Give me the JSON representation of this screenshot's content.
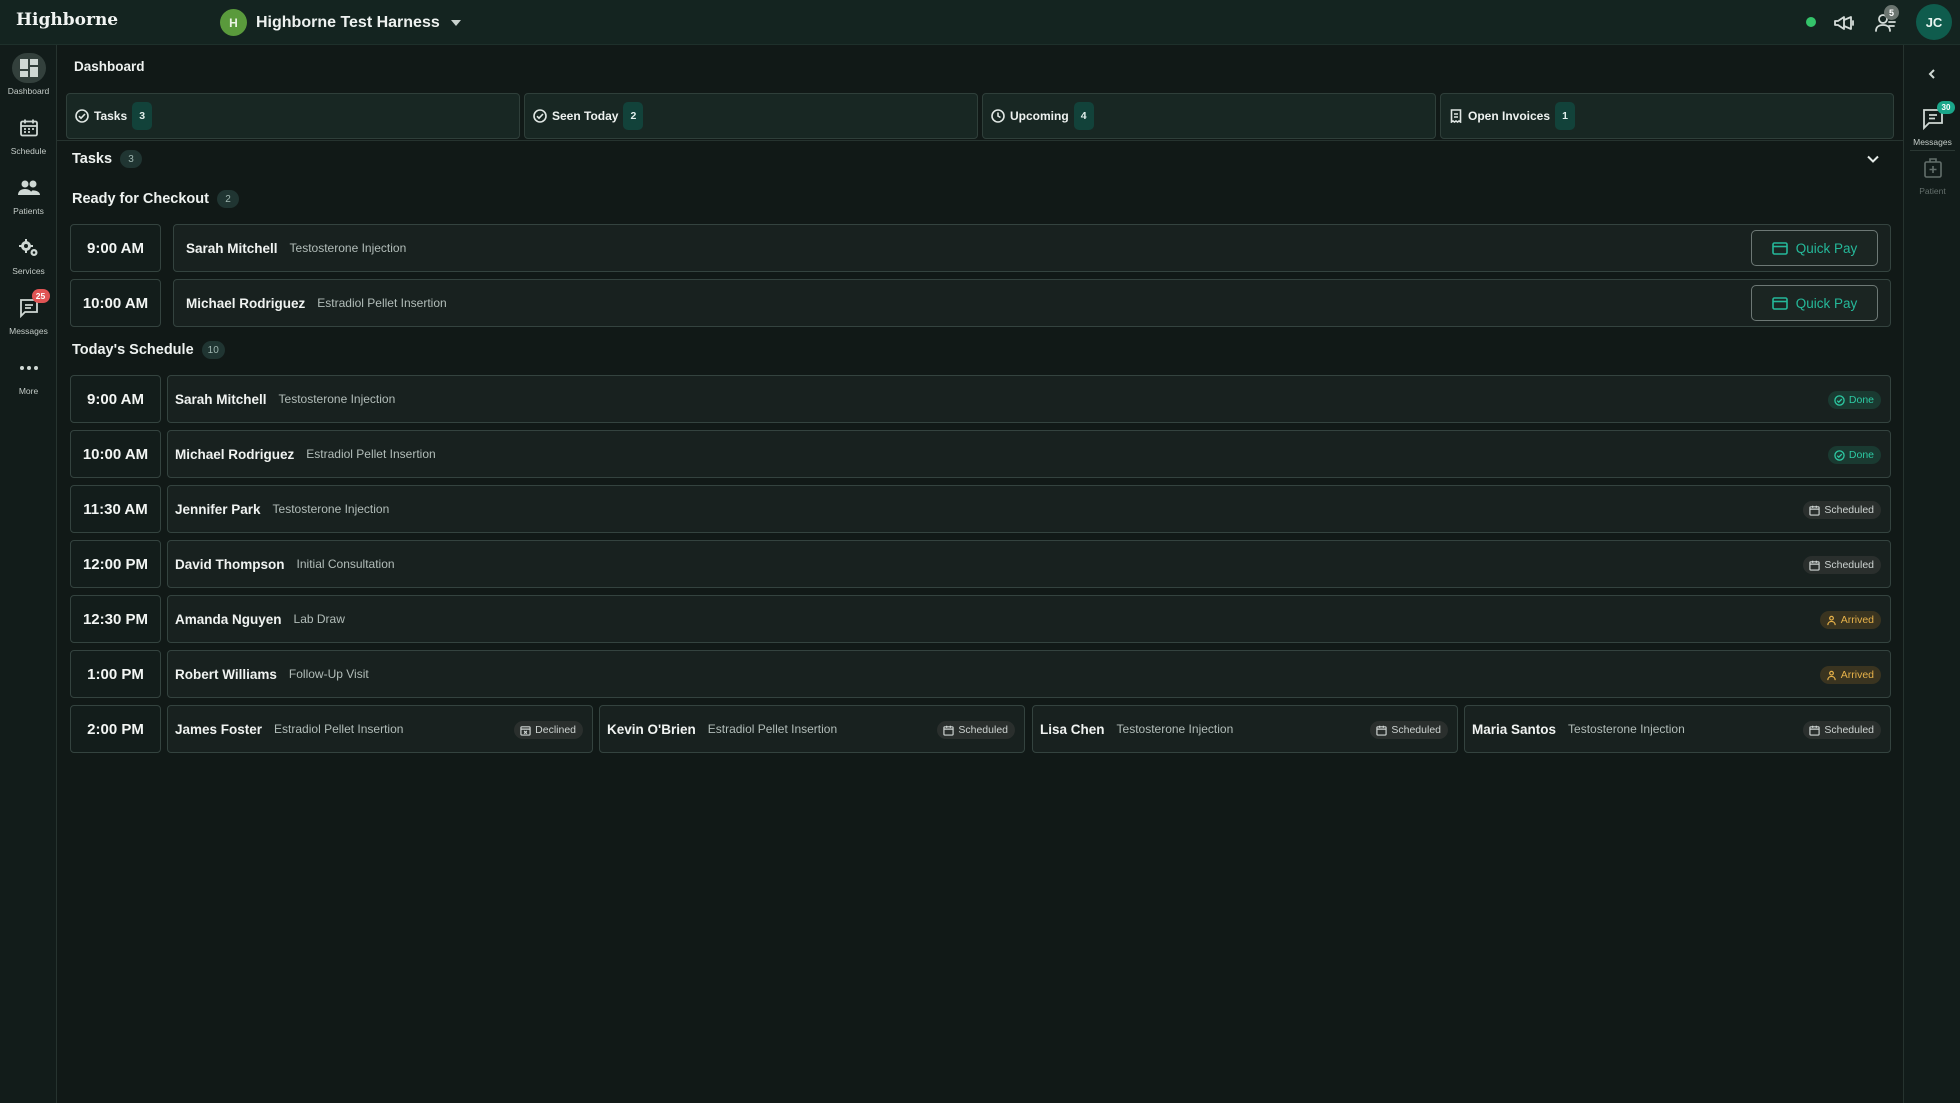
{
  "app": {
    "brand": "Highborne",
    "org_initial": "H",
    "org_name": "Highborne Test Harness",
    "user_initials": "JC",
    "team_badge": "5"
  },
  "nav": [
    {
      "label": "Dashboard",
      "icon": "dashboard-icon"
    },
    {
      "label": "Schedule",
      "icon": "calendar-icon"
    },
    {
      "label": "Patients",
      "icon": "people-icon"
    },
    {
      "label": "Services",
      "icon": "gears-icon"
    },
    {
      "label": "Messages",
      "icon": "chat-icon",
      "badge": "25"
    },
    {
      "label": "More",
      "icon": "more-icon"
    }
  ],
  "rail": [
    {
      "label": "Messages",
      "icon": "chat-icon",
      "badge": "30"
    },
    {
      "label": "Patient",
      "icon": "patient-icon"
    }
  ],
  "page_title": "Dashboard",
  "tabs": [
    {
      "label": "Tasks",
      "count": "3",
      "icon": "check-circle-icon"
    },
    {
      "label": "Seen Today",
      "count": "2",
      "icon": "check-circle-icon"
    },
    {
      "label": "Upcoming",
      "count": "4",
      "icon": "clock-icon"
    },
    {
      "label": "Open Invoices",
      "count": "1",
      "icon": "receipt-icon"
    }
  ],
  "tasks": {
    "title": "Tasks",
    "count": "3"
  },
  "checkout": {
    "title": "Ready for Checkout",
    "count": "2",
    "button_label": "Quick Pay",
    "rows": [
      {
        "time": "9:00 AM",
        "name": "Sarah Mitchell",
        "service": "Testosterone Injection"
      },
      {
        "time": "10:00 AM",
        "name": "Michael Rodriguez",
        "service": "Estradiol Pellet Insertion"
      }
    ]
  },
  "schedule": {
    "title": "Today's Schedule",
    "count": "10",
    "rows": [
      {
        "time": "9:00 AM",
        "appts": [
          {
            "name": "Sarah Mitchell",
            "service": "Testosterone Injection",
            "status": "Done",
            "kind": "done"
          }
        ]
      },
      {
        "time": "10:00 AM",
        "appts": [
          {
            "name": "Michael Rodriguez",
            "service": "Estradiol Pellet Insertion",
            "status": "Done",
            "kind": "done"
          }
        ]
      },
      {
        "time": "11:30 AM",
        "appts": [
          {
            "name": "Jennifer Park",
            "service": "Testosterone Injection",
            "status": "Scheduled",
            "kind": "scheduled"
          }
        ]
      },
      {
        "time": "12:00 PM",
        "appts": [
          {
            "name": "David Thompson",
            "service": "Initial Consultation",
            "status": "Scheduled",
            "kind": "scheduled"
          }
        ]
      },
      {
        "time": "12:30 PM",
        "appts": [
          {
            "name": "Amanda Nguyen",
            "service": "Lab Draw",
            "status": "Arrived",
            "kind": "arrived"
          }
        ]
      },
      {
        "time": "1:00 PM",
        "appts": [
          {
            "name": "Robert Williams",
            "service": "Follow-Up Visit",
            "status": "Arrived",
            "kind": "arrived"
          }
        ]
      },
      {
        "time": "2:00 PM",
        "appts": [
          {
            "name": "James Foster",
            "service": "Estradiol Pellet Insertion",
            "status": "Declined",
            "kind": "declined"
          },
          {
            "name": "Kevin O'Brien",
            "service": "Estradiol Pellet Insertion",
            "status": "Scheduled",
            "kind": "scheduled"
          },
          {
            "name": "Lisa Chen",
            "service": "Testosterone Injection",
            "status": "Scheduled",
            "kind": "scheduled"
          },
          {
            "name": "Maria Santos",
            "service": "Testosterone Injection",
            "status": "Scheduled",
            "kind": "scheduled"
          }
        ]
      }
    ]
  },
  "colors": {
    "accent": "#25b899",
    "done": "#2dcaa3",
    "arrived": "#e7b24a",
    "badge_red": "#e05454",
    "online": "#34c36a"
  }
}
